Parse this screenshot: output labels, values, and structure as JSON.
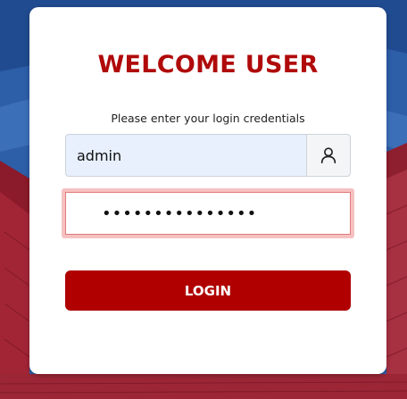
{
  "login": {
    "title": "WELCOME USER",
    "subtitle": "Please enter your login credentials",
    "username_value": "admin",
    "password_value": "•••••••••••••••",
    "login_label": "LOGIN",
    "user_icon": "user-icon"
  },
  "colors": {
    "brand_red": "#b00000",
    "title_red": "#b00a0a",
    "autofill_blue": "#e8f0fe",
    "error_border": "#f6c1c1"
  }
}
